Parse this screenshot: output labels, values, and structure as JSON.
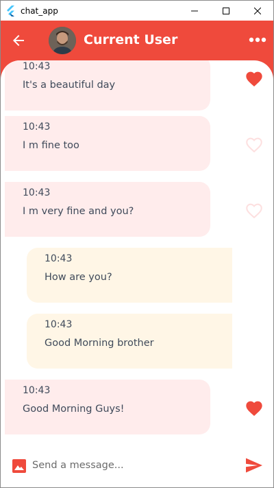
{
  "window": {
    "title": "chat_app"
  },
  "appbar": {
    "user_name": "Current User"
  },
  "messages": [
    {
      "time": "10:43",
      "text": "It's a beautiful day",
      "side": "recv",
      "liked": true
    },
    {
      "time": "10:43",
      "text": "I m fine too",
      "side": "recv",
      "liked": false
    },
    {
      "time": "10:43",
      "text": "I m very fine and you?",
      "side": "recv",
      "liked": false
    },
    {
      "time": "10:43",
      "text": "How are you?",
      "side": "sent",
      "liked": null
    },
    {
      "time": "10:43",
      "text": "Good Morning brother",
      "side": "sent",
      "liked": null
    },
    {
      "time": "10:43",
      "text": "Good Morning Guys!",
      "side": "recv",
      "liked": true
    }
  ],
  "composer": {
    "placeholder": "Send a message..."
  },
  "colors": {
    "primary": "#ef4a3c",
    "received_bubble": "#ffecec",
    "sent_bubble": "#fff6e6",
    "heart_empty": "#fde3e3",
    "text": "#3f4a5a"
  },
  "icons": [
    "flutter-icon",
    "minimize-icon",
    "maximize-icon",
    "close-icon",
    "back-arrow-icon",
    "more-horiz-icon",
    "heart-icon",
    "image-icon",
    "send-icon"
  ]
}
